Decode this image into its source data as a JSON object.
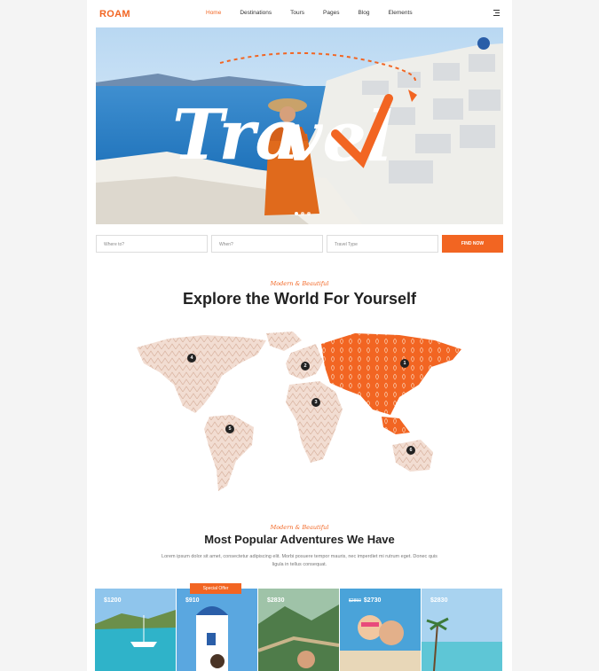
{
  "nav": {
    "logo": "ROAM",
    "items": [
      {
        "label": "Home",
        "active": true
      },
      {
        "label": "Destinations"
      },
      {
        "label": "Tours"
      },
      {
        "label": "Pages"
      },
      {
        "label": "Blog"
      },
      {
        "label": "Elements"
      }
    ]
  },
  "hero": {
    "headline": "Travel",
    "slides": 3,
    "active_slide": 1
  },
  "search": {
    "where": "Where to?",
    "when": "When?",
    "type": "Travel Type",
    "button": "FIND NOW"
  },
  "explore": {
    "eyebrow": "Modern & Beautiful",
    "title": "Explore the World For Yourself"
  },
  "map": {
    "pins": [
      "1",
      "2",
      "3",
      "4",
      "5",
      "6"
    ]
  },
  "adventures": {
    "eyebrow": "Modern & Beautiful",
    "title": "Most Popular Adventures We Have",
    "text": "Lorem ipsum dolor sit amet, consectetur adipiscing elit. Morbi posuere tempor mauris, nec imperdiet mi rutrum eget. Donec quis ligula in tellus consequat."
  },
  "cards": [
    {
      "price": "$1200"
    },
    {
      "price": "$910",
      "badge": "Special Offer"
    },
    {
      "price": "$2830"
    },
    {
      "old_price": "$2850",
      "price": "$2730"
    },
    {
      "price": "$2830"
    }
  ],
  "colors": {
    "accent": "#f26522",
    "dark": "#222222"
  }
}
